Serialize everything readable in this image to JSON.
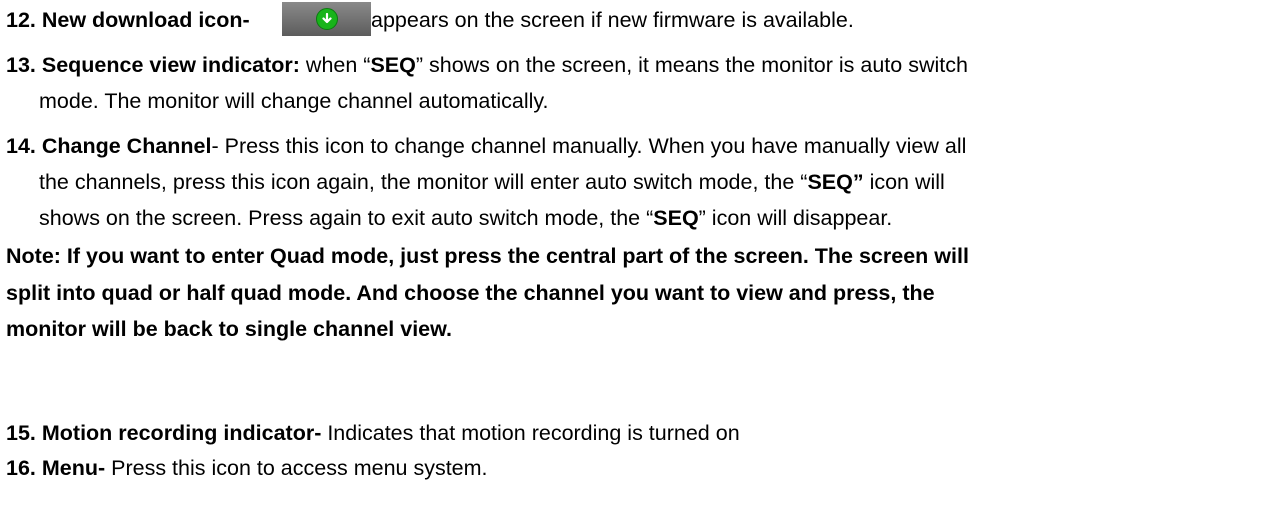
{
  "item12": {
    "label": "12. New download icon-",
    "text": "appears on the screen if new firmware is available.",
    "icon": "download-arrow-icon",
    "icon_color": "#18b41a"
  },
  "item13": {
    "label": "13. Sequence view indicator:",
    "text_a": " when “",
    "seq": "SEQ",
    "text_b": "” shows on the screen, it means the monitor is auto switch",
    "text_c": "mode. The monitor will change channel automatically."
  },
  "item14": {
    "label": "14. Change Channel",
    "text_a": "- Press this icon to change channel manually. When you have manually view all",
    "text_b": "the channels, press this icon again, the monitor will enter auto switch mode, the “",
    "seq1": "SEQ”",
    "text_c": " icon will",
    "text_d": "shows on the screen. Press again to exit auto switch mode, the “",
    "seq2": "SEQ",
    "text_e": "” icon will disappear."
  },
  "note": {
    "line1": "Note: If you want to enter Quad mode, just press the central part of the screen. The screen will",
    "line2": "split into quad or half quad mode. And choose the channel you want to view and press, the",
    "line3": "monitor will be back to single channel view."
  },
  "item15": {
    "label": "15. Motion recording indicator-",
    "text": " Indicates that motion recording is turned on"
  },
  "item16": {
    "label": "16. Menu-",
    "text": " Press this icon to access menu system."
  }
}
